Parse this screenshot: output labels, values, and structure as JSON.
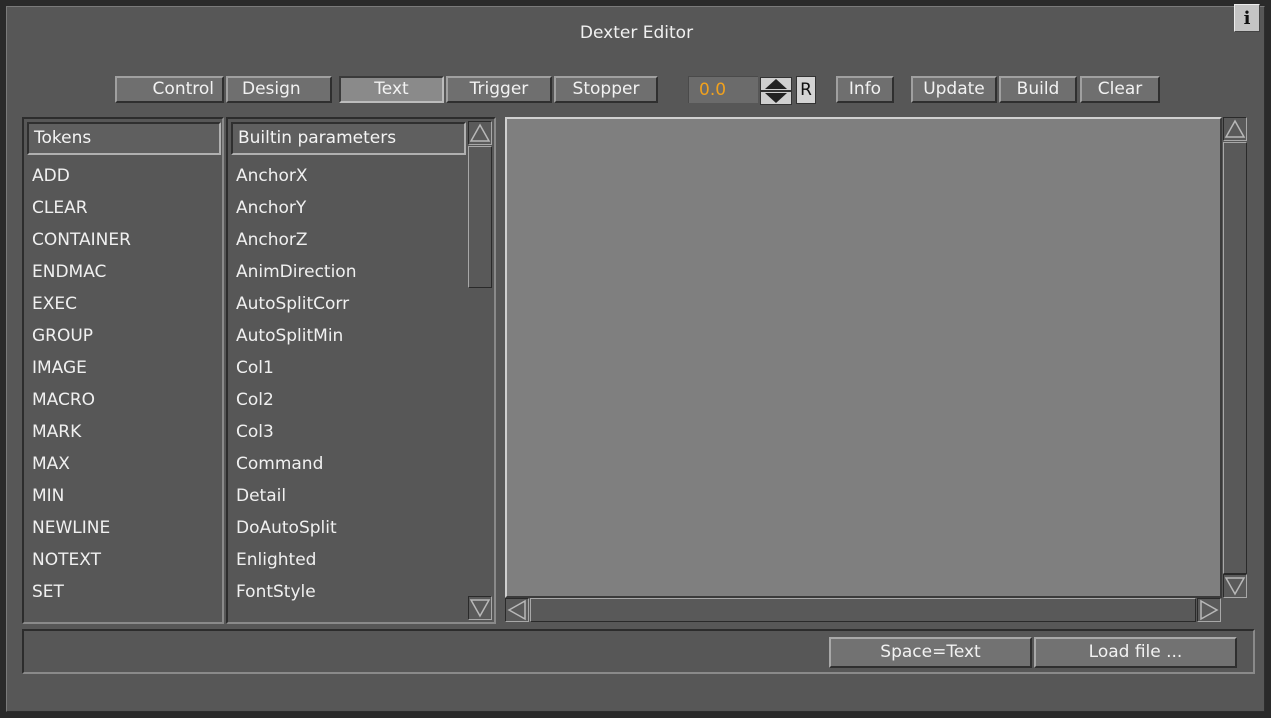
{
  "window": {
    "title": "Dexter Editor",
    "info_icon": "i"
  },
  "toolbar": {
    "modes": [
      "Control",
      "Design",
      "Text",
      "Trigger",
      "Stopper"
    ],
    "selected_mode": "Text",
    "value": "0.0",
    "reset_label": "R",
    "info_label": "Info",
    "update_label": "Update",
    "build_label": "Build",
    "clear_label": "Clear"
  },
  "tokens": {
    "header": "Tokens",
    "items": [
      "ADD",
      "CLEAR",
      "CONTAINER",
      "ENDMAC",
      "EXEC",
      "GROUP",
      "IMAGE",
      "MACRO",
      "MARK",
      "MAX",
      "MIN",
      "NEWLINE",
      "NOTEXT",
      "SET"
    ]
  },
  "builtins": {
    "header": "Builtin parameters",
    "items": [
      "AnchorX",
      "AnchorY",
      "AnchorZ",
      "AnimDirection",
      "AutoSplitCorr",
      "AutoSplitMin",
      "Col1",
      "Col2",
      "Col3",
      "Command",
      "Detail",
      "DoAutoSplit",
      "Enlighted",
      "FontStyle"
    ]
  },
  "footer": {
    "space_text_label": "Space=Text",
    "load_file_label": "Load file ..."
  },
  "colors": {
    "value_text": "#f0a11e",
    "background": "#575757",
    "editor": "#7f7f7f"
  },
  "icons": [
    "info-icon",
    "arrow-up-icon",
    "arrow-down-icon",
    "arrow-left-icon",
    "arrow-right-icon"
  ]
}
